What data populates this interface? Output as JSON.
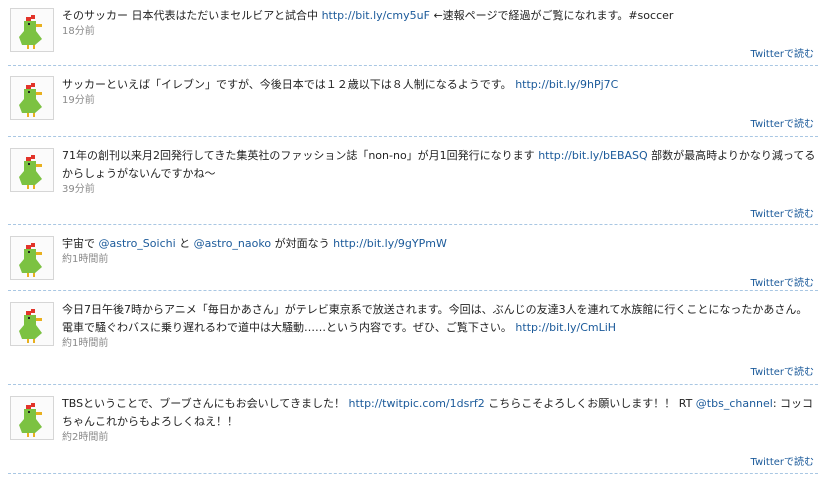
{
  "read_label": "Twitterで読む",
  "colors": {
    "link": "#1b5a9a",
    "separator": "#a9c7e3",
    "avatar_bird": "#7cc242",
    "avatar_comb": "#e2342a"
  },
  "tweets": [
    {
      "icon": "green-bird-avatar",
      "text": "そのサッカー 日本代表はただいまセルビアと試合中 ",
      "link": "http://bit.ly/cmy5uF",
      "text2": " ←速報ページで経過がご覧になれます。#soccer",
      "time": "18分前"
    },
    {
      "icon": "green-bird-avatar",
      "text": "サッカーといえば「イレブン」ですが、今後日本では１２歳以下は８人制になるようです。 ",
      "link": "http://bit.ly/9hPj7C",
      "time": "19分前"
    },
    {
      "icon": "green-bird-avatar",
      "text": "71年の創刊以来月2回発行してきた集英社のファッション誌「non-no」が月1回発行になります ",
      "link": "http://bit.ly/bEBASQ",
      "text2": " 部数が最高時よりかなり減ってるからしょうがないんですかね〜",
      "time": "39分前"
    },
    {
      "icon": "green-bird-avatar",
      "text": "宇宙で ",
      "mention1": "@astro_Soichi",
      "text2": " と ",
      "mention2": "@astro_naoko",
      "text3": " が対面なう ",
      "link": "http://bit.ly/9gYPmW",
      "time": "約1時間前"
    },
    {
      "icon": "green-bird-avatar",
      "text": "今日7日午後7時からアニメ「毎日かあさん」がテレビ東京系で放送されます。今回は、ぶんじの友達3人を連れて水族館に行くことになったかあさん。電車で騒ぐわバスに乗り遅れるわで道中は大騒動……という内容です。ぜひ、ご覧下さい。 ",
      "link": "http://bit.ly/CmLiH",
      "time": "約1時間前"
    },
    {
      "icon": "green-bird-avatar",
      "text": "TBSということで、ブーブさんにもお会いしてきました！ ",
      "link": "http://twitpic.com/1dsrf2",
      "text2": " こちらこそよろしくお願いします！！ RT ",
      "mention1": "@tbs_channel",
      "text3": ": コッコちゃんこれからもよろしくねえ！！",
      "time": "約2時間前"
    }
  ]
}
